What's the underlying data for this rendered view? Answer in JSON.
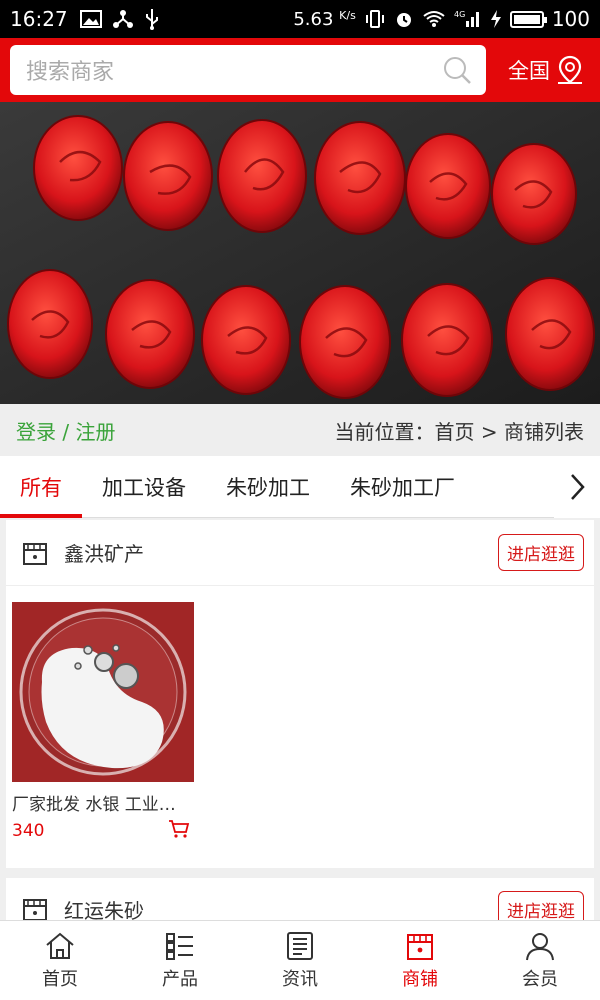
{
  "status_bar": {
    "time": "16:27",
    "speed": "5.63",
    "speed_unit": "K/s",
    "signal_label": "4G",
    "battery": "100",
    "icons": [
      "image-icon",
      "share-icon",
      "usb-icon",
      "vibrate-icon",
      "alarm-icon",
      "wifi-icon",
      "signal-icon",
      "charging-icon",
      "battery-icon"
    ]
  },
  "header": {
    "search_placeholder": "搜索商家",
    "region_label": "全国",
    "accent_color": "#e3080a"
  },
  "banner": {
    "alt": "red cinnabar carved pendants"
  },
  "breadcrumb": {
    "login": "登录 / 注册",
    "location": "当前位置：首页 > 商铺列表"
  },
  "tabs": [
    "所有",
    "加工设备",
    "朱砂加工",
    "朱砂加工厂"
  ],
  "shops": [
    {
      "name": "鑫洪矿产",
      "visit_label": "进店逛逛",
      "product": {
        "name": "厂家批发 水银 工业…",
        "price": "340"
      }
    },
    {
      "name": "红运朱砂",
      "visit_label": "进店逛逛"
    }
  ],
  "bottom_nav": [
    {
      "label": "首页",
      "icon": "home-icon"
    },
    {
      "label": "产品",
      "icon": "grid-list-icon"
    },
    {
      "label": "资讯",
      "icon": "news-icon"
    },
    {
      "label": "商铺",
      "icon": "store-icon",
      "active": true
    },
    {
      "label": "会员",
      "icon": "user-icon"
    }
  ]
}
